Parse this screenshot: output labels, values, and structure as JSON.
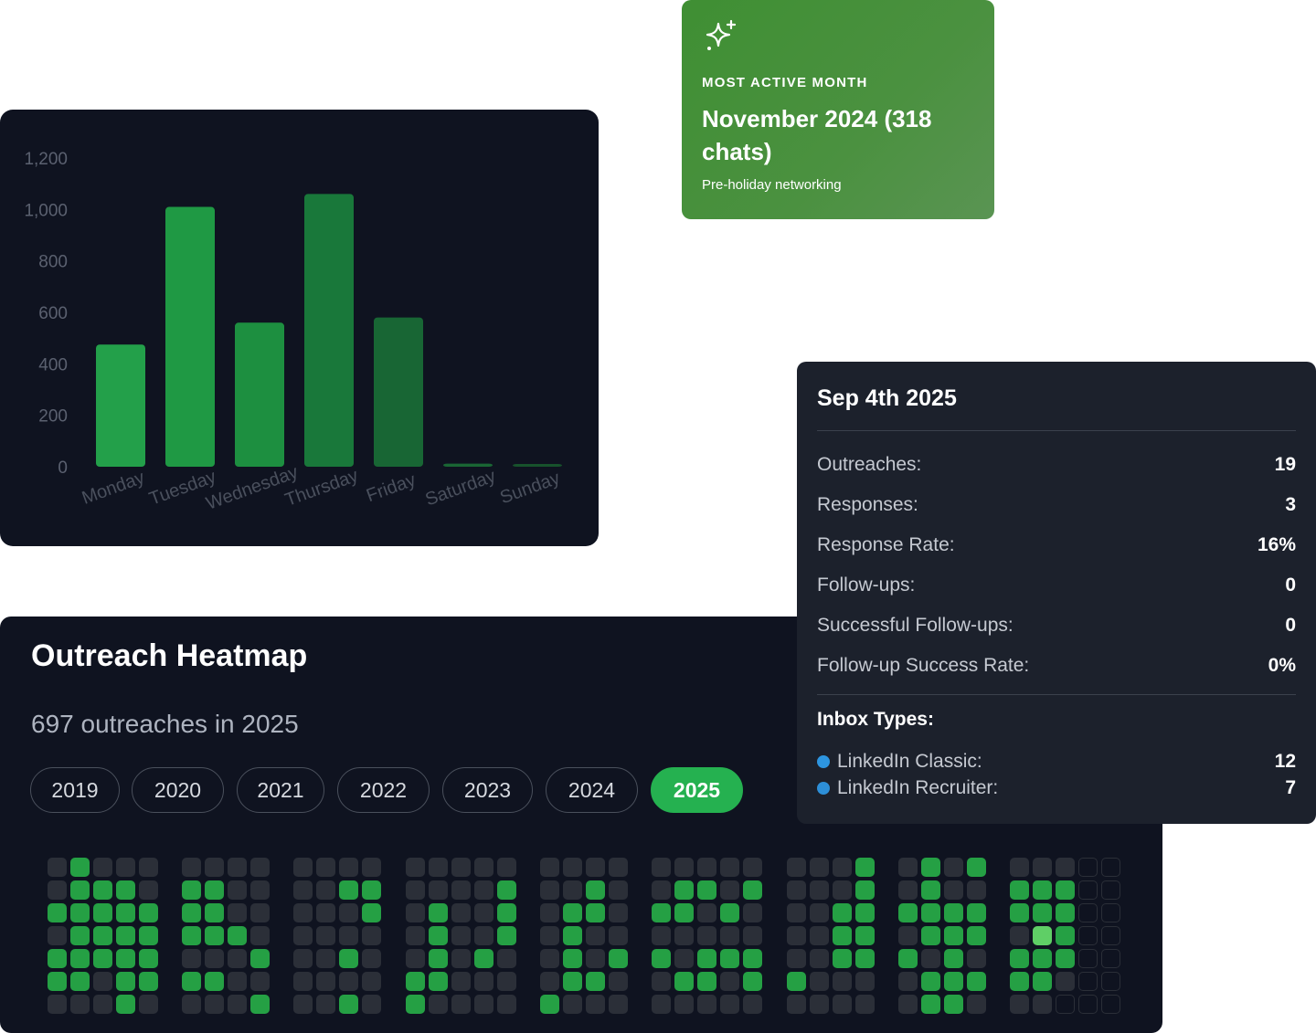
{
  "chart_data": {
    "type": "bar",
    "categories": [
      "Monday",
      "Tuesday",
      "Wednesday",
      "Thursday",
      "Friday",
      "Saturday",
      "Sunday"
    ],
    "values": [
      475,
      1010,
      560,
      1060,
      580,
      12,
      6
    ],
    "ylim": [
      0,
      1200
    ],
    "yticks": [
      "0",
      "200",
      "400",
      "600",
      "800",
      "1,000",
      "1,200"
    ],
    "grid": false,
    "bar_colors": [
      "#23a04a",
      "#1f9944",
      "#1d8f40",
      "#19783a",
      "#186634",
      "#1a6634",
      "#17522c"
    ]
  },
  "month_card": {
    "icon": "sparkle-icon",
    "eyebrow": "MOST ACTIVE MONTH",
    "headline": "November 2024 (318 chats)",
    "sub": "Pre-holiday networking"
  },
  "heatmap": {
    "title": "Outreach Heatmap",
    "summary": "697 outreaches in 2025",
    "years": [
      "2019",
      "2020",
      "2021",
      "2022",
      "2023",
      "2024",
      "2025"
    ],
    "active_year": "2025",
    "colors": {
      "empty": "#2b2f38",
      "active": "#25a044",
      "highlight": "#5fcf66",
      "future": "#0f1320",
      "future_border": "#2b2f38"
    },
    "weeks": [
      "0010000000000110000000000",
      "0000000000100100011100110",
      "0111001100001000010011000",
      "0111000000110011011000011",
      "0111010100000000010000000",
      "0000000000000100000000000",
      "0000000000011000000000100",
      "0000000110000000001100000",
      "0000000000000001100000100",
      "0000000000100010101100000",
      "0000000000010000100000000",
      "0000000000000010000000000"
    ],
    "grid_rows": [
      [
        0,
        1,
        0,
        0,
        0,
        0,
        0,
        0,
        0,
        0,
        0,
        0,
        0,
        0,
        0,
        0,
        0,
        0,
        0,
        0,
        0,
        0,
        0,
        0,
        0,
        0,
        0,
        0,
        0,
        0,
        1,
        0,
        1,
        0,
        1,
        0,
        0,
        0,
        -1,
        -1
      ],
      [
        0,
        1,
        1,
        1,
        0,
        1,
        1,
        0,
        0,
        0,
        0,
        1,
        1,
        0,
        0,
        0,
        0,
        1,
        0,
        0,
        1,
        0,
        0,
        1,
        1,
        0,
        1,
        0,
        0,
        0,
        1,
        0,
        1,
        0,
        0,
        1,
        1,
        1,
        -1,
        -1
      ],
      [
        1,
        1,
        1,
        1,
        1,
        1,
        1,
        0,
        0,
        0,
        0,
        0,
        1,
        0,
        1,
        0,
        0,
        1,
        0,
        1,
        1,
        0,
        1,
        1,
        0,
        1,
        0,
        0,
        0,
        1,
        1,
        1,
        1,
        1,
        1,
        1,
        1,
        1,
        -1,
        -1
      ],
      [
        0,
        1,
        1,
        1,
        1,
        1,
        1,
        1,
        0,
        0,
        0,
        0,
        0,
        0,
        1,
        0,
        0,
        1,
        0,
        1,
        0,
        0,
        0,
        0,
        0,
        0,
        0,
        0,
        0,
        1,
        1,
        0,
        1,
        1,
        1,
        0,
        2,
        1,
        -1,
        -1
      ],
      [
        1,
        1,
        1,
        1,
        1,
        0,
        0,
        0,
        1,
        0,
        0,
        1,
        0,
        0,
        1,
        0,
        1,
        0,
        0,
        1,
        0,
        1,
        1,
        0,
        1,
        1,
        1,
        0,
        0,
        1,
        1,
        1,
        0,
        1,
        0,
        1,
        1,
        1,
        -1,
        -1
      ],
      [
        1,
        1,
        0,
        1,
        1,
        1,
        1,
        0,
        0,
        0,
        0,
        0,
        0,
        1,
        1,
        0,
        0,
        0,
        0,
        1,
        1,
        0,
        0,
        1,
        1,
        0,
        1,
        1,
        0,
        0,
        0,
        0,
        1,
        1,
        1,
        1,
        1,
        0,
        -1,
        -1
      ],
      [
        0,
        0,
        0,
        1,
        0,
        0,
        0,
        0,
        1,
        0,
        0,
        1,
        0,
        1,
        0,
        0,
        0,
        0,
        1,
        0,
        0,
        0,
        0,
        0,
        0,
        0,
        0,
        0,
        0,
        0,
        0,
        0,
        1,
        1,
        0,
        0,
        0,
        -1,
        -1,
        -1
      ]
    ]
  },
  "tooltip": {
    "title": "Sep 4th 2025",
    "stats": [
      {
        "label": "Outreaches:",
        "value": "19"
      },
      {
        "label": "Responses:",
        "value": "3"
      },
      {
        "label": "Response Rate:",
        "value": "16%"
      },
      {
        "label": "Follow-ups:",
        "value": "0"
      },
      {
        "label": "Successful Follow-ups:",
        "value": "0"
      },
      {
        "label": "Follow-up Success Rate:",
        "value": "0%"
      }
    ],
    "inbox_title": "Inbox Types:",
    "inbox": [
      {
        "label": "LinkedIn Classic:",
        "value": "12",
        "color": "#2d95e0"
      },
      {
        "label": "LinkedIn Recruiter:",
        "value": "7",
        "color": "#2d8fd8"
      }
    ]
  }
}
